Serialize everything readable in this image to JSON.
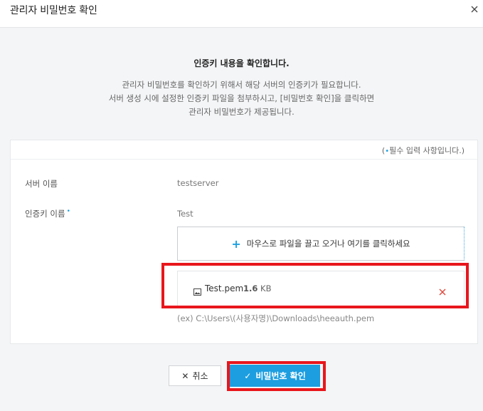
{
  "dialog": {
    "title": "관리자 비밀번호 확인",
    "close_icon": "close-icon"
  },
  "intro": {
    "title": "인증키 내용을 확인합니다.",
    "lines": [
      "관리자 비밀번호를 확인하기 위해서 해당 서버의 인증키가 필요합니다.",
      "서버 생성 시에 설정한 인증키 파일을 첨부하시고, [비밀번호 확인]을 클릭하면",
      "관리자 비밀번호가 제공됩니다."
    ]
  },
  "form": {
    "required_note_prefix": "(",
    "required_note_dot": "•",
    "required_note_text": "필수 입력 사항입니다.)",
    "server_name": {
      "label": "서버 이름",
      "value": "testserver"
    },
    "auth_key": {
      "label": "인증키 이름",
      "required_mark": "•",
      "value": "Test"
    },
    "dropzone": {
      "plus": "+",
      "text": "마우스로 파일을 끌고 오거나 여기를 클릭하세요"
    },
    "file": {
      "icon": "image-file-icon",
      "name": "Test.pem",
      "size_value": "1.6",
      "size_unit": "KB",
      "remove_icon": "remove-icon"
    },
    "example_path": "(ex) C:\\Users\\(사용자명)\\Downloads\\heeauth.pem"
  },
  "buttons": {
    "cancel_icon": "✕",
    "cancel_label": "취소",
    "confirm_icon": "✓",
    "confirm_label": "비밀번호 확인"
  },
  "colors": {
    "accent": "#1d9ee0",
    "highlight": "#e8161c",
    "remove": "#e0453a"
  }
}
